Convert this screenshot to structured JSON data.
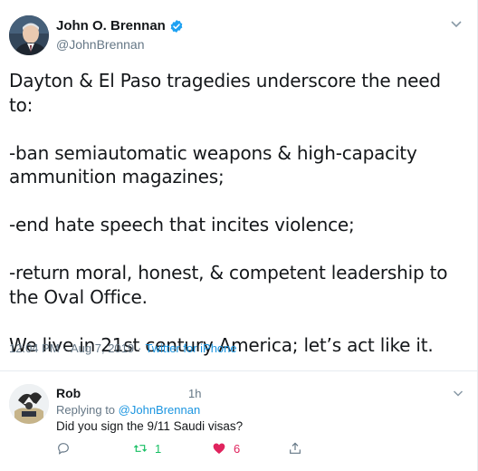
{
  "tweet": {
    "author_name": "John O. Brennan",
    "author_handle": "@JohnBrennan",
    "verified": true,
    "text": "Dayton & El Paso tragedies underscore the need to:\n\n-ban semiautomatic weapons & high-capacity ammunition magazines;\n\n-end hate speech that incites violence;\n\n-return moral, honest, & competent leadership to the Oval Office.\n\nWe live in 21st century America; let’s act like it.",
    "time": "12:04 PM",
    "date": "Aug 7, 2019",
    "separator": "·",
    "source": "Twitter for iPhone"
  },
  "reply": {
    "author_name": "Rob",
    "time_ago": "1h",
    "replying_prefix": "Replying to",
    "replying_to": "@JohnBrennan",
    "text": "Did you sign the 9/11 Saudi visas?",
    "actions": {
      "reply_count": "",
      "retweet_count": "1",
      "like_count": "6"
    }
  },
  "icons": {
    "verified": "verified-badge-icon",
    "menu": "chevron-down-icon",
    "reply": "reply-bubble-icon",
    "retweet": "retweet-icon",
    "like": "heart-icon",
    "share": "share-icon"
  },
  "colors": {
    "text": "#14171a",
    "secondary": "#657786",
    "link": "#1b95e0",
    "retweet": "#17bf63",
    "like": "#e0245e",
    "verified": "#1da1f2"
  }
}
